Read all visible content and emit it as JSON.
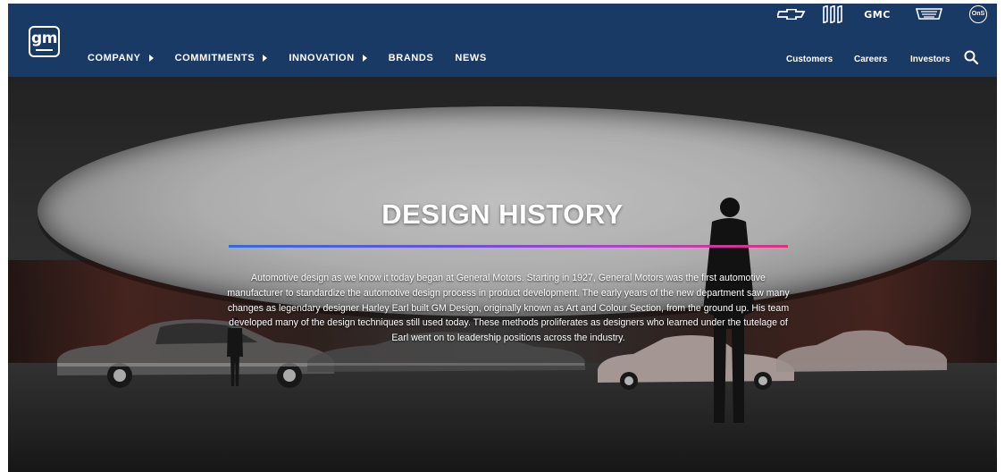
{
  "header": {
    "logo": {
      "text": "gm",
      "icon": "gm-logo-icon"
    },
    "nav": [
      {
        "label": "COMPANY",
        "has_menu": true
      },
      {
        "label": "COMMITMENTS",
        "has_menu": true
      },
      {
        "label": "INNOVATION",
        "has_menu": true
      },
      {
        "label": "BRANDS",
        "has_menu": false
      },
      {
        "label": "NEWS",
        "has_menu": false
      }
    ],
    "brands": [
      {
        "name": "chevrolet",
        "icon": "chevrolet-logo-icon"
      },
      {
        "name": "buick",
        "icon": "buick-logo-icon"
      },
      {
        "name": "gmc",
        "icon": "gmc-logo-icon",
        "text": "GMC"
      },
      {
        "name": "cadillac",
        "icon": "cadillac-logo-icon"
      },
      {
        "name": "onstar",
        "icon": "onstar-logo-icon",
        "text": "OnStar"
      }
    ],
    "links": [
      "Customers",
      "Careers",
      "Investors"
    ],
    "search_icon": "search-icon",
    "background": "#1a3a66"
  },
  "hero": {
    "title": "DESIGN HISTORY",
    "rule_colors": [
      "#2f6ce0",
      "#b23fd0",
      "#e0307c"
    ],
    "body": "Automotive design as we know it today began at General Motors.  Starting in 1927, General Motors was the first automotive manufacturer to standardize the automotive design process in product development.  The early years of the new department saw many changes as legendary designer Harley Earl built GM Design, originally known as Art and Colour Section, from the ground up. His team developed many of the design techniques still used today. These methods proliferates as designers who learned under the tutelage of Earl went on to leadership positions across the industry."
  }
}
